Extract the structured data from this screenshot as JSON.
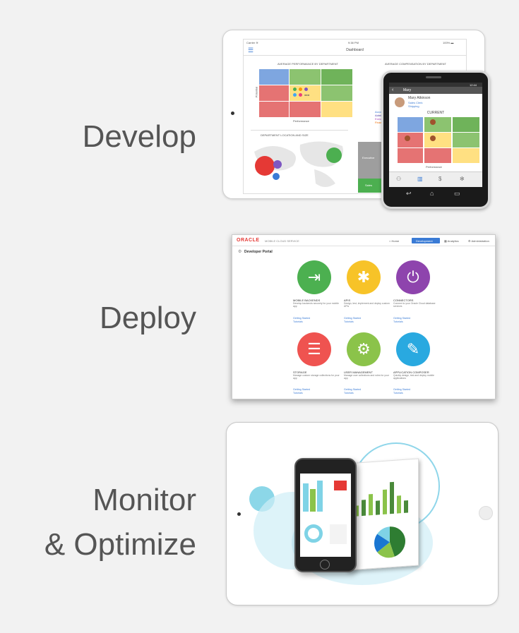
{
  "steps": {
    "develop": "Develop",
    "deploy": "Deploy",
    "monitor_line1": "Monitor",
    "monitor_line2": "& Optimize"
  },
  "dashboard": {
    "title": "Dashboard",
    "status_left": "Carrier ≋",
    "status_time": "9:38 PM",
    "status_battery": "100% ▬",
    "panel1_title": "AVERAGE PERFORMANCE BY DEPARTMENT",
    "panel2_title": "AVERAGE COMPENSATION BY DEPARTMENT",
    "panel3_title": "DEPARTMENT LOCATION AND SIZE",
    "axis_performance": "Performance",
    "axis_potential": "Potential",
    "legend": [
      "Accounting",
      "Administration",
      "Executive",
      "Finance"
    ],
    "bar_label_exec": "Executive",
    "bar_label_sales": "Sales"
  },
  "phone": {
    "header_name": "Mary",
    "person_name": "Mary Atkinson",
    "person_role": "Sales Clerk",
    "person_loc": "Shipping",
    "section": "CURRENT",
    "axis": "Performance",
    "time": "12:44"
  },
  "portal": {
    "brand": "ORACLE",
    "subtitle": "MOBILE CLOUD SERVICE",
    "nav": [
      "Home",
      "Development",
      "Analytics",
      "Administration"
    ],
    "page_title": "Developer Portal",
    "tiles": [
      {
        "title": "MOBILE BACKENDS",
        "desc": "Develop backends securely for your mobile app",
        "link1": "Getting Started",
        "link2": "Tutorials",
        "color": "#4cb050"
      },
      {
        "title": "APIS",
        "desc": "Design, test, implement and deploy custom APIs",
        "link1": "Getting Started",
        "link2": "Tutorials",
        "color": "#f7c328"
      },
      {
        "title": "CONNECTORS",
        "desc": "Connect to your Oracle Cloud database services",
        "link1": "Getting Started",
        "link2": "Tutorials",
        "color": "#8e44ad"
      },
      {
        "title": "STORAGE",
        "desc": "Manage custom storage collections for your app",
        "link1": "Getting Started",
        "link2": "Tutorials",
        "color": "#ef5350"
      },
      {
        "title": "USER MANAGEMENT",
        "desc": "Manage user collections and roles for your app",
        "link1": "Getting Started",
        "link2": "Tutorials",
        "color": "#8bc34a"
      },
      {
        "title": "APPLICATION COMPOSER",
        "desc": "Quickly design, test and deploy mobile applications",
        "link1": "Getting Started",
        "link2": "Tutorials",
        "color": "#29a9e0"
      }
    ]
  },
  "analytics": {
    "bars": [
      0.3,
      0.45,
      0.6,
      0.4,
      0.7,
      0.9,
      0.5,
      0.35
    ],
    "pie": [
      0.45,
      0.2,
      0.2,
      0.15
    ]
  }
}
